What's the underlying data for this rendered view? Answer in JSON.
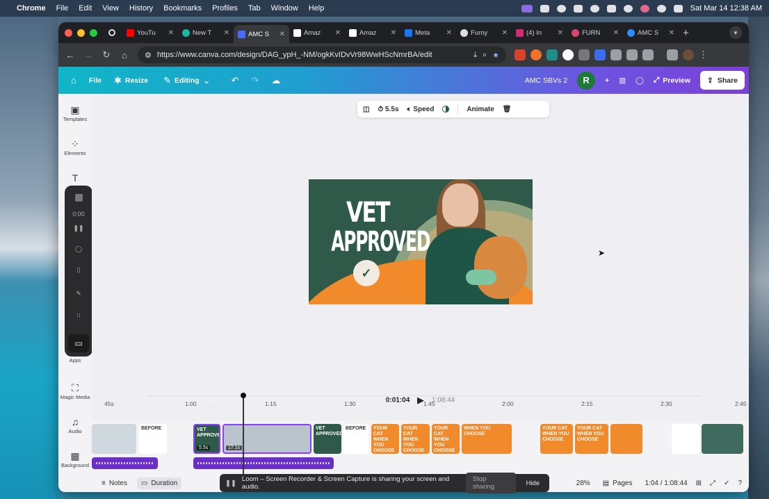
{
  "menubar": {
    "app": "Chrome",
    "items": [
      "File",
      "Edit",
      "View",
      "History",
      "Bookmarks",
      "Profiles",
      "Tab",
      "Window",
      "Help"
    ],
    "datetime": "Sat Mar 14  12:38 AM"
  },
  "tabs": [
    {
      "label": "YouTu",
      "color": "#ff0000"
    },
    {
      "label": "New T",
      "color": "#1cb6a6"
    },
    {
      "label": "AMC S",
      "color": "#4b6bff",
      "active": true
    },
    {
      "label": "Amaz",
      "color": "#ffffff"
    },
    {
      "label": "Amaz",
      "color": "#ffffff"
    },
    {
      "label": "Meta",
      "color": "#1877f2"
    },
    {
      "label": "Furny",
      "color": "#dddddd"
    },
    {
      "label": "(4) In",
      "color": "#d62976"
    },
    {
      "label": "FURN",
      "color": "#e0436a"
    },
    {
      "label": "AMC S",
      "color": "#2d8cff"
    }
  ],
  "address": {
    "url": "https://www.canva.com/design/DAG_ypH_-NM/ogkKvIDvVr98WwHScNmrBA/edit"
  },
  "canva_header": {
    "file": "File",
    "resize": "Resize",
    "editing": "Editing",
    "doc_title": "AMC SBVs 2",
    "avatar_initial": "R",
    "preview": "Preview",
    "share": "Share"
  },
  "rail": {
    "templates": "Templates",
    "elements": "Elements",
    "apps": "Apps",
    "magic_media": "Magic Media",
    "audio": "Audio",
    "background": "Background",
    "recorder_time": "0:00"
  },
  "context_toolbar": {
    "duration": "5.5s",
    "speed": "Speed",
    "animate": "Animate"
  },
  "design": {
    "line1": "VET",
    "line2": "APPROVED",
    "check": "✓"
  },
  "playback": {
    "current": "0:01:04",
    "total": "1:08:44"
  },
  "timeline": {
    "ticks": [
      "45s",
      "1:00",
      "1:15",
      "1:30",
      "1:45",
      "2:00",
      "2:15",
      "2:30",
      "2:45"
    ],
    "clips": [
      {
        "label": "",
        "color": "#cfd8de"
      },
      {
        "label": "BEFORE",
        "color": "#ffffff"
      },
      {
        "label": "VET APPROVED",
        "color": "#2f5a49",
        "duration": "5.5s"
      },
      {
        "label": "",
        "color": "#b9c4cc",
        "duration": "17.1s"
      },
      {
        "label": "VET APPROVED",
        "color": "#2f5a49"
      },
      {
        "label": "BEFORE",
        "color": "#ffffff"
      },
      {
        "label": "YOUR CAT WHEN YOU CHOOSE",
        "color": "#f08a2a"
      },
      {
        "label": "YOUR CAT WHEN YOU CHOOSE",
        "color": "#f08a2a"
      },
      {
        "label": "YOUR CAT WHEN YOU CHOOSE",
        "color": "#f08a2a"
      },
      {
        "label": "WHEN YOU CHOOSE",
        "color": "#f08a2a"
      },
      {
        "label": "YOUR CAT WHEN YOU CHOOSE",
        "color": "#f08a2a"
      },
      {
        "label": "YOUR CAT WHEN YOU CHOOSE",
        "color": "#f08a2a"
      },
      {
        "label": "",
        "color": "#f08a2a"
      },
      {
        "label": "",
        "color": "#ffffff"
      },
      {
        "label": "",
        "color": "#3f6a5e"
      }
    ]
  },
  "bottombar": {
    "notes": "Notes",
    "duration": "Duration",
    "zoom": "28%",
    "pages": "Pages",
    "time": "1:04 / 1:08:44"
  },
  "loom": {
    "message": "Loom – Screen Recorder & Screen Capture is sharing your screen and audio.",
    "stop": "Stop sharing",
    "hide": "Hide"
  },
  "colors": {
    "canva_purple": "#8b3dff",
    "canva_teal": "#10b5c7",
    "design_green": "#2f5a49",
    "design_orange": "#f08a2a"
  }
}
